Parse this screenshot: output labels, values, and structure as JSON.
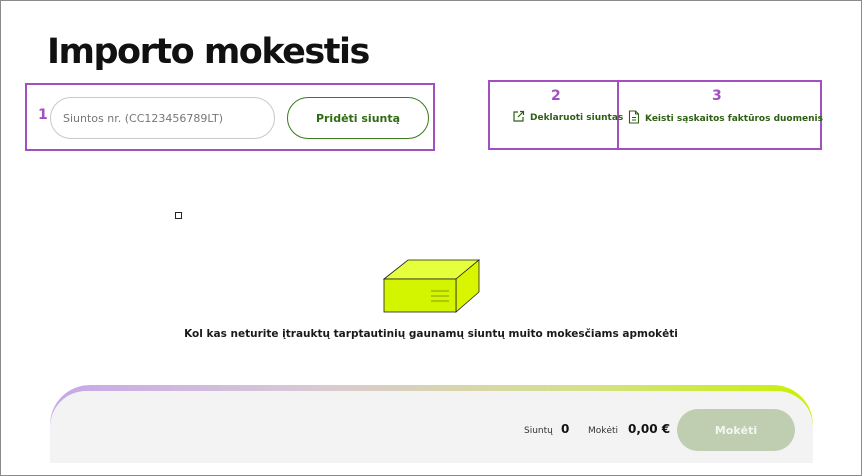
{
  "page": {
    "title": "Importo mokestis"
  },
  "annotations": {
    "n1": "1",
    "n2": "2",
    "n3": "3"
  },
  "search": {
    "placeholder": "Siuntos nr. (CC123456789LT)",
    "value": ""
  },
  "toolbar": {
    "add_label": "Pridėti siuntą",
    "declare_label": "Deklaruoti siuntas",
    "invoice_label": "Keisti sąskaitos faktūros duomenis"
  },
  "empty_state": {
    "message": "Kol kas neturite įtrauktų tarptautinių gaunamų siuntų muito mokesčiams apmokėti"
  },
  "summary": {
    "shipments_label": "Siuntų",
    "shipments_count": "0",
    "pay_label": "Mokėti",
    "pay_amount": "0,00 €",
    "pay_button": "Mokėti"
  },
  "colors": {
    "annotation": "#a24fbf",
    "accent_green": "#2f6b12",
    "lime": "#d4f500",
    "pay_button_disabled": "#bfcdb0"
  },
  "icons": [
    "external-link-icon",
    "document-icon",
    "package-box-icon"
  ]
}
